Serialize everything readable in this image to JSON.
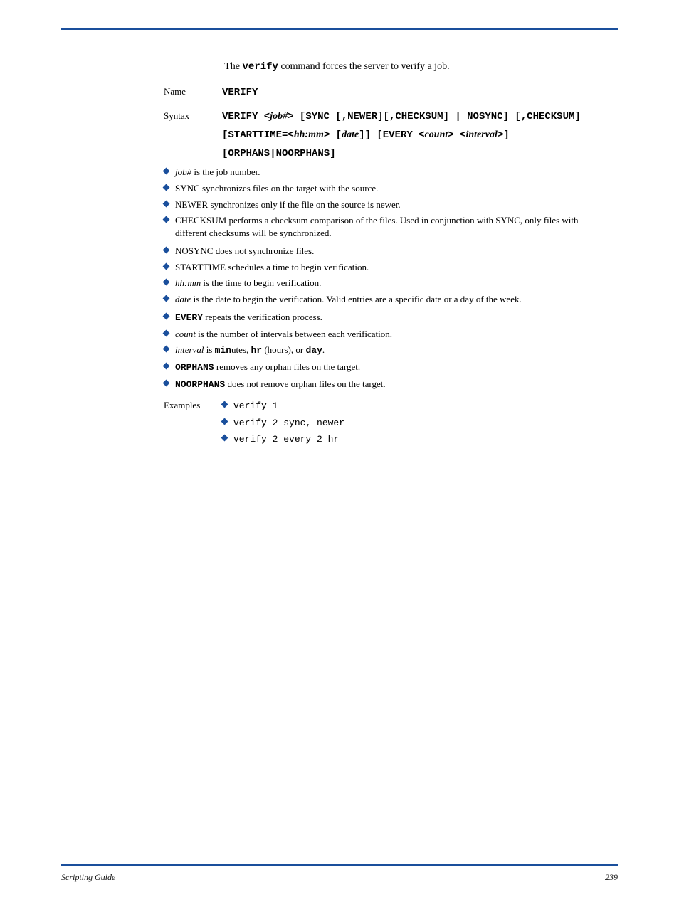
{
  "intro": {
    "before": "The ",
    "cmd": "verify",
    "after": " command forces the server to verify a job."
  },
  "labels": {
    "name": "Name",
    "syntax": "Syntax",
    "examples": "Examples"
  },
  "nameSection": {
    "value": "VERIFY"
  },
  "syntax": {
    "l1": {
      "a": "VERIFY <",
      "b": "job#",
      "c": "> [SYNC [,NEWER][,CHECKSUM] | NOSYNC] [,CHECKSUM]"
    },
    "l2": {
      "a": "[STARTTIME=<",
      "b": "hh:mm",
      "c": "> [",
      "d": "date",
      "e": "]]  [EVERY <",
      "f": "count",
      "g": "> <",
      "h": "interval",
      "i": ">]"
    },
    "l3": "[ORPHANS|NOORPHANS]"
  },
  "params": [
    {
      "k": "job#",
      "v": "is the job number."
    },
    {
      "k": "SYNC",
      "v": "synchronizes files on the target with the source."
    },
    {
      "k": "NEWER",
      "v": "synchronizes only if the file on the source is newer."
    },
    {
      "k": "CHECKSUM",
      "v": "performs a checksum comparison of the files. Used in conjunction with SYNC, only files with different checksums will be synchronized."
    },
    {
      "k": "NOSYNC",
      "v": "does not synchronize files."
    },
    {
      "k": "STARTTIME",
      "v": "schedules a time to begin verification."
    },
    {
      "k": "hh:mm",
      "v": "is the time to begin verification."
    },
    {
      "k": "date",
      "v": "is the date to begin the verification. Valid entries are a specific date or a day of the week."
    },
    {
      "k": "EVERY",
      "v": "repeats the verification process."
    },
    {
      "k": "count",
      "v": "is the number of intervals between each verification."
    },
    {
      "k": "interval",
      "pre": " is ",
      "a": "min",
      "s1": "utes, ",
      "b": "hr",
      "s2": " (hours), or ",
      "c": "day",
      "post": "."
    },
    {
      "k": "ORPHANS",
      "v": "removes any orphan files on the target."
    },
    {
      "k": "NOORPHANS",
      "v": "does not remove orphan files on the target."
    }
  ],
  "examples": [
    "verify 1",
    "verify 2 sync, newer",
    "verify 2 every 2 hr"
  ],
  "footer": {
    "left": "Scripting Guide",
    "right": "239"
  }
}
